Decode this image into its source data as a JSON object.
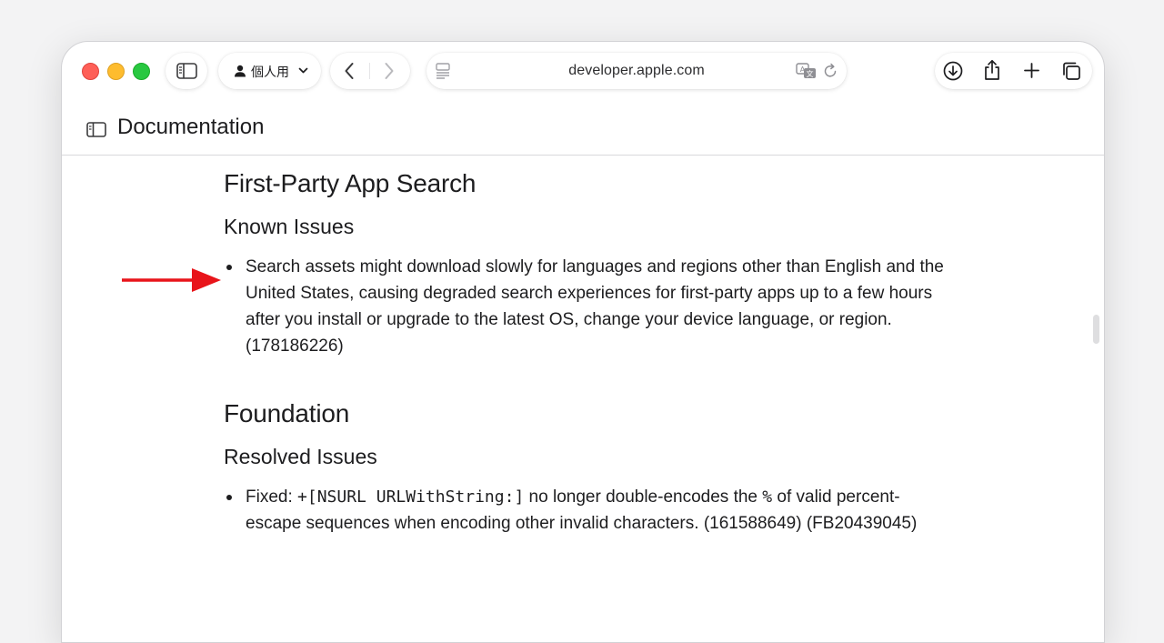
{
  "toolbar": {
    "profile_label": "個人用",
    "url": "developer.apple.com"
  },
  "icons": {
    "sidebar": "sidebar-icon",
    "profile": "person-icon",
    "chevron": "chevron-down-icon",
    "back": "back-chevron-icon",
    "forward": "forward-chevron-icon",
    "reader": "reader-icon",
    "translate": "translate-icon",
    "reload": "reload-icon",
    "download": "download-icon",
    "share": "share-icon",
    "new_tab": "plus-icon",
    "tabs": "tab-overview-icon"
  },
  "header": {
    "title": "Documentation"
  },
  "sections": [
    {
      "title": "First-Party App Search",
      "subtitle": "Known Issues",
      "items": [
        "Search assets might download slowly for languages and regions other than English and the United States, causing degraded search experiences for first-party apps up to a few hours after you install or upgrade to the latest OS, change your device language, or region. (178186226)"
      ]
    },
    {
      "title": "Foundation",
      "subtitle": "Resolved Issues",
      "items": [
        {
          "prefix": "Fixed: ",
          "code": "+[NSURL URLWithString:]",
          "middle": " no longer double-encodes the ",
          "code2": "%",
          "suffix": " of valid percent-escape sequences when encoding other invalid characters. (161588649) (FB20439045)"
        }
      ]
    }
  ],
  "colors": {
    "close": "#fe5f57",
    "minimize": "#febc2e",
    "zoom": "#28c840",
    "annotation_arrow": "#e8141a"
  }
}
